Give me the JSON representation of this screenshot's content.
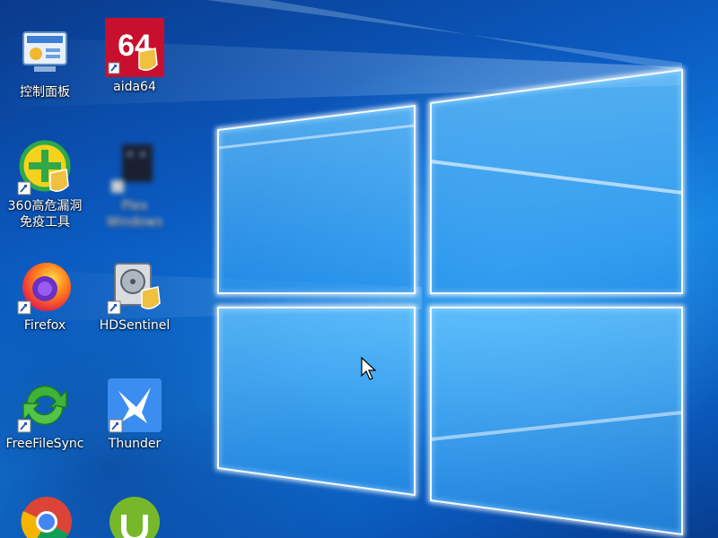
{
  "desktop": {
    "icons": [
      {
        "label": "控制面板",
        "icon": "control-panel-icon"
      },
      {
        "label": "aida64",
        "icon": "aida64-icon",
        "badge": "64"
      },
      {
        "label_line1": "360高危漏洞",
        "label_line2": "免疫工具",
        "icon": "360-security-icon"
      },
      {
        "label_line1": "Plex",
        "label_line2": "Windows",
        "icon": "blurred-app-icon"
      },
      {
        "label": "Firefox",
        "icon": "firefox-icon"
      },
      {
        "label": "HDSentinel",
        "icon": "hdsentinel-icon"
      },
      {
        "label": "FreeFileSync",
        "icon": "freefilesync-icon"
      },
      {
        "label": "Thunder",
        "icon": "thunder-icon"
      },
      {
        "label": "",
        "icon": "chrome-icon"
      },
      {
        "label": "",
        "icon": "utorrent-icon"
      }
    ]
  },
  "colors": {
    "wallpaper_light": "#7fd0ff",
    "wallpaper_dark": "#0a3a8c",
    "label_text": "#ffffff"
  }
}
